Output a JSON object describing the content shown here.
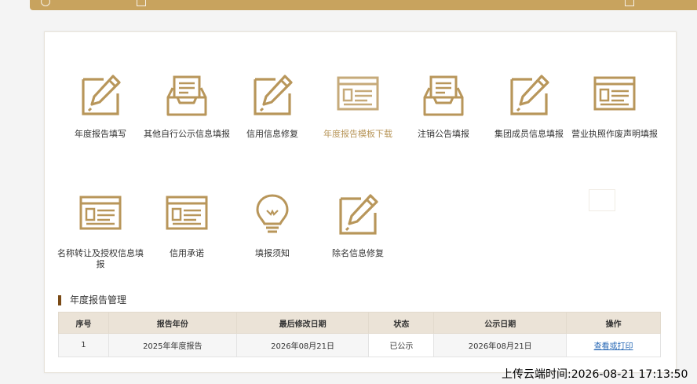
{
  "colors": {
    "accent": "#b8965a",
    "header": "#c8a35e",
    "link": "#2a6ab6"
  },
  "menu": [
    {
      "label": "年度报告填写",
      "icon": "edit-icon"
    },
    {
      "label": "其他自行公示信息填报",
      "icon": "inbox-icon"
    },
    {
      "label": "信用信息修复",
      "icon": "edit-icon"
    },
    {
      "label": "年度报告模板下载",
      "icon": "window-form-icon",
      "active": true
    },
    {
      "label": "注销公告填报",
      "icon": "inbox-icon"
    },
    {
      "label": "集团成员信息填报",
      "icon": "edit-icon"
    },
    {
      "label": "营业执照作废声明填报",
      "icon": "window-form-icon"
    },
    {
      "label": "名称转让及授权信息填报",
      "icon": "window-form-icon"
    },
    {
      "label": "信用承诺",
      "icon": "window-form-icon"
    },
    {
      "label": "填报须知",
      "icon": "lightbulb-icon"
    },
    {
      "label": "除名信息修复",
      "icon": "edit-icon"
    }
  ],
  "report_section": {
    "title": "年度报告管理",
    "columns": [
      "序号",
      "报告年份",
      "最后修改日期",
      "状态",
      "公示日期",
      "操作"
    ],
    "rows": [
      {
        "no": "1",
        "year": "2025年年度报告",
        "modified": "2026年08月21日",
        "status": "已公示",
        "published": "2026年08月21日",
        "action": "查看或打印"
      }
    ]
  },
  "upload_time": "上传云端时间:2026-08-21 17:13:50"
}
